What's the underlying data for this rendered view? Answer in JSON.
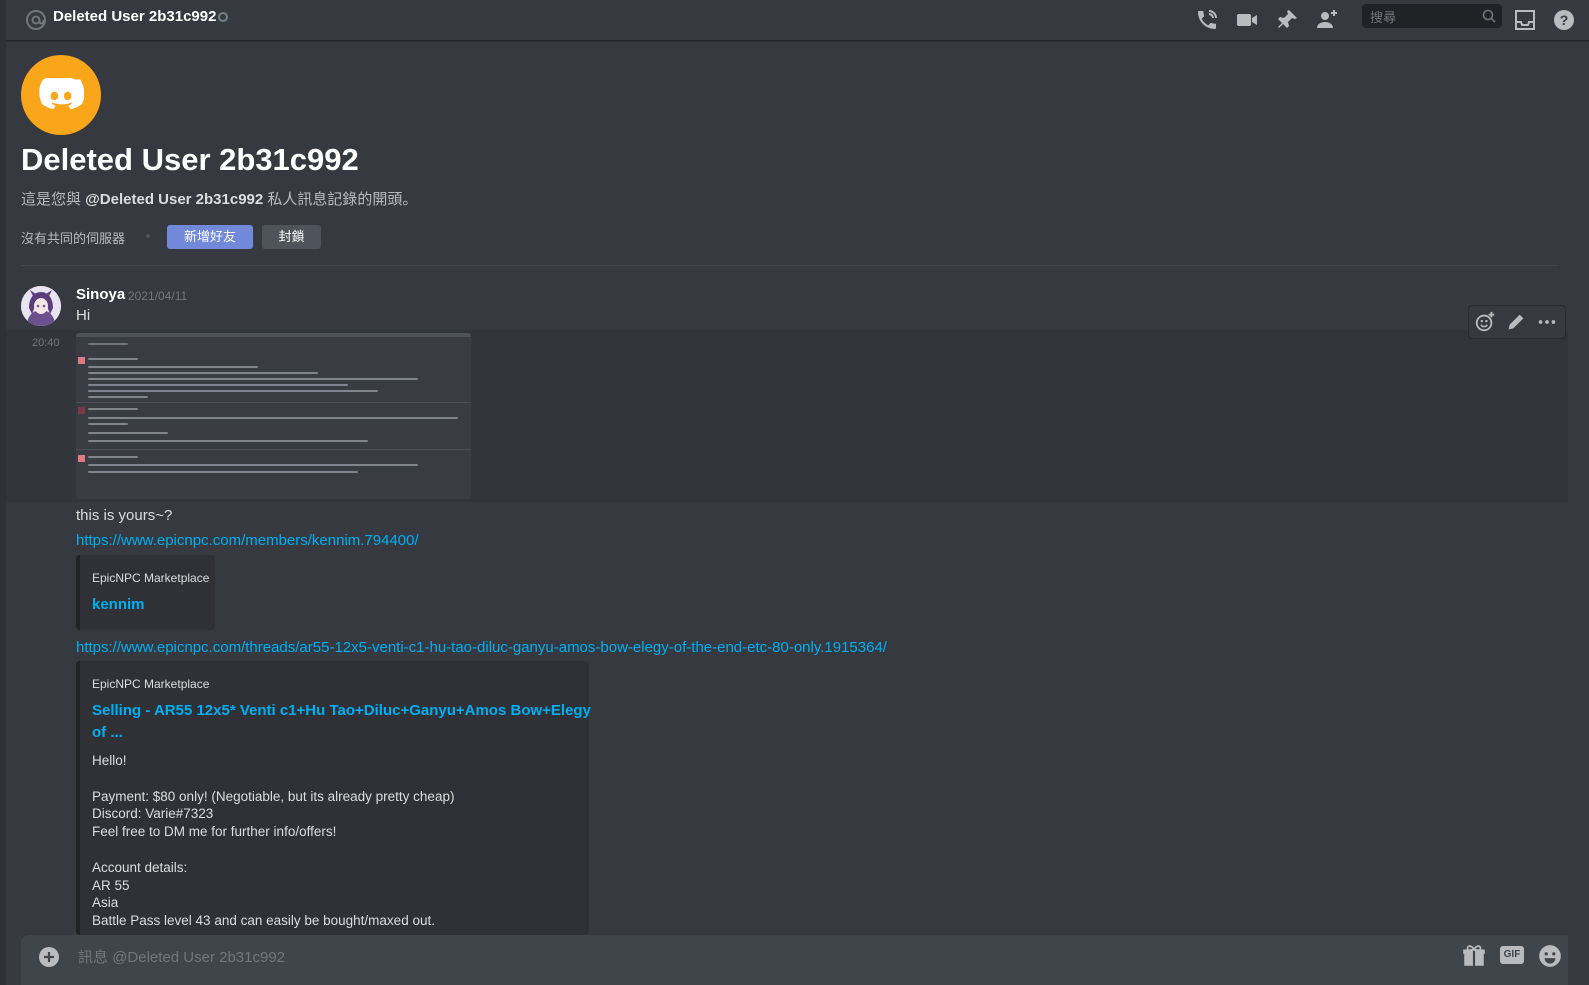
{
  "header": {
    "title": "Deleted User 2b31c992",
    "search_placeholder": "搜尋"
  },
  "welcome": {
    "name": "Deleted User 2b31c992",
    "desc_prefix": "這是您與 ",
    "desc_user": "@Deleted User 2b31c992",
    "desc_suffix": " 私人訊息記錄的開頭。",
    "mutual_servers": "沒有共同的伺服器",
    "add_friend": "新增好友",
    "block": "封鎖"
  },
  "message": {
    "author": "Sinoya",
    "date": "2021/04/11",
    "hover_time": "20:40",
    "lines": {
      "hi": "Hi",
      "question": "this is yours~?",
      "link1": "https://www.epicnpc.com/members/kennim.794400/",
      "link2": "https://www.epicnpc.com/threads/ar55-12x5-venti-c1-hu-tao-diluc-ganyu-amos-bow-elegy-of-the-end-etc-80-only.1915364/"
    }
  },
  "embeds": [
    {
      "provider": "EpicNPC Marketplace",
      "title": "kennim"
    },
    {
      "provider": "EpicNPC Marketplace",
      "title_line1": "Selling - AR55 12x5* Venti c1+Hu Tao+Diluc+Ganyu+Amos Bow+Elegy",
      "title_line2": "of ...",
      "description": "Hello!\n\nPayment: $80 only! (Negotiable, but its already pretty cheap)\nDiscord: Varie#7323\nFeel free to DM me for further info/offers!\n\nAccount details:\nAR 55\nAsia\nBattle Pass level 43 and can easily be bought/maxed out."
    }
  ],
  "composer": {
    "placeholder": "訊息 @Deleted User 2b31c992",
    "gif_label": "GIF"
  },
  "colors": {
    "background": "#36393f",
    "blurple": "#7289da",
    "link": "#00b0f4",
    "avatar_orange": "#faa61a"
  }
}
